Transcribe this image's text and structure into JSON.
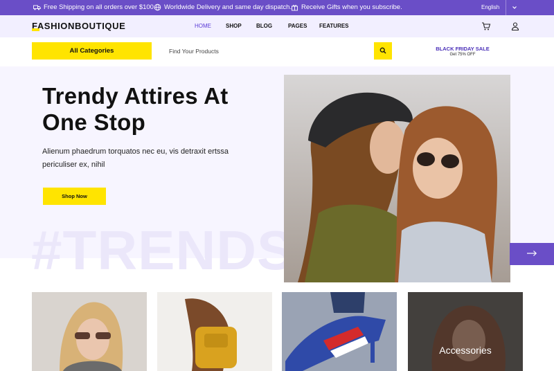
{
  "topbar": {
    "shipping": "Free Shipping on all orders over $100.",
    "delivery": "Worldwide Delivery and same day dispatch.",
    "gifts": "Receive Gifts when you subscribe.",
    "language": "English"
  },
  "nav": {
    "logo": "FASHIONBOUTIQUE",
    "links": [
      "HOME",
      "SHOP",
      "BLOG",
      "PAGES",
      "FEATURES"
    ],
    "active": "HOME"
  },
  "search": {
    "category_button": "All Categories",
    "placeholder": "Find Your Products"
  },
  "promo": {
    "title": "BLACK FRIDAY SALE",
    "subtitle": "Get 75% OFF"
  },
  "hero": {
    "title": "Trendy Attires At One Stop",
    "subtitle": "Alienum phaedrum torquatos nec eu, vis detraxit ertssa periculiser ex, nihil",
    "button": "Shop Now",
    "watermark": "#TRENDS"
  },
  "categories": [
    {
      "label": ""
    },
    {
      "label": ""
    },
    {
      "label": ""
    },
    {
      "label": "Accessories"
    }
  ],
  "colors": {
    "accent": "#6a4ec7",
    "highlight": "#ffe400",
    "hero_bg": "#f7f5ff",
    "nav_bg": "#f2efff"
  },
  "icons": {
    "shipping": "truck-icon",
    "delivery": "globe-icon",
    "gifts": "gift-icon",
    "cart": "cart-icon",
    "account": "user-icon",
    "search": "search-icon",
    "next": "arrow-right-icon"
  }
}
